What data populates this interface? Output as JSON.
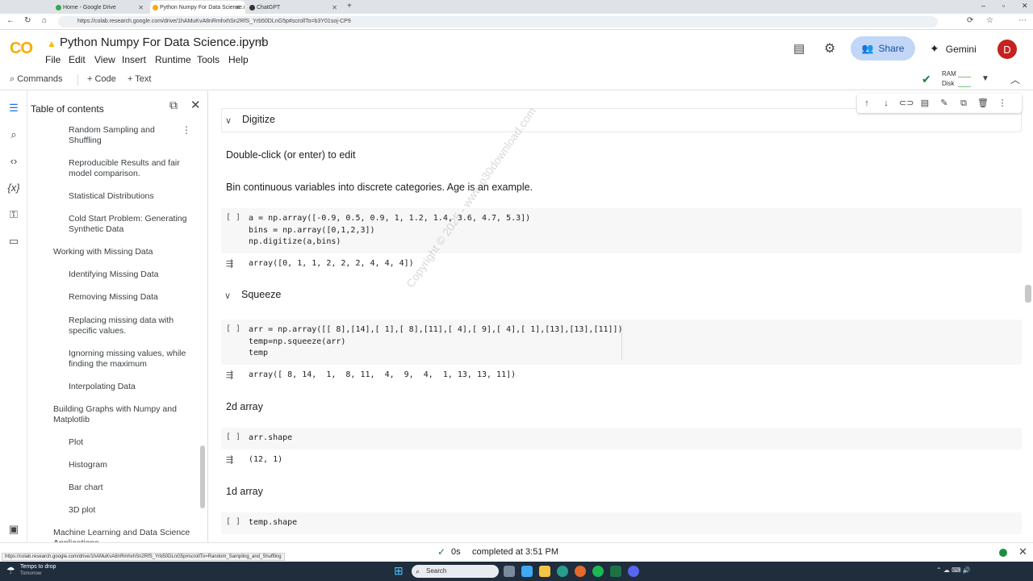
{
  "browser": {
    "tabs": [
      {
        "label": "Home - Google Drive",
        "active": false
      },
      {
        "label": "Python Numpy For Data Science.i",
        "active": true
      },
      {
        "label": "ChatGPT",
        "active": false
      }
    ],
    "url": "https://colab.research.google.com/drive/1hAMuKvA8nRmhxhSn2RfS_Yrb50DLnG5p#scrollTo=b3Y01soj-CP9"
  },
  "header": {
    "logo": "CO",
    "title": "Python Numpy For Data Science.ipynb",
    "menus": [
      "File",
      "Edit",
      "View",
      "Insert",
      "Runtime",
      "Tools",
      "Help"
    ],
    "share_label": "Share",
    "gemini_label": "Gemini",
    "avatar_letter": "D"
  },
  "toolbar": {
    "commands_label": "Commands",
    "code_label": "+ Code",
    "text_label": "+ Text",
    "ram_label": "RAM",
    "disk_label": "Disk"
  },
  "toc": {
    "title": "Table of contents",
    "items": [
      {
        "label": "Random Sampling and Shuffling",
        "level": 2
      },
      {
        "label": "Reproducible Results and fair model comparison.",
        "level": 2
      },
      {
        "label": "Statistical Distributions",
        "level": 2
      },
      {
        "label": "Cold Start Problem: Generating Synthetic Data",
        "level": 2
      },
      {
        "label": "Working with Missing Data",
        "level": 1
      },
      {
        "label": "Identifying Missing Data",
        "level": 2
      },
      {
        "label": "Removing Missing Data",
        "level": 2
      },
      {
        "label": "Replacing missing data with specific values.",
        "level": 2
      },
      {
        "label": "Ignorning missing values, while finding the maximum",
        "level": 2
      },
      {
        "label": "Interpolating Data",
        "level": 2
      },
      {
        "label": "Building Graphs with Numpy and Matplotlib",
        "level": 1
      },
      {
        "label": "Plot",
        "level": 2
      },
      {
        "label": "Histogram",
        "level": 2
      },
      {
        "label": "Bar chart",
        "level": 2
      },
      {
        "label": "3D plot",
        "level": 2
      },
      {
        "label": "Machine Learning and Data Science Applications",
        "level": 1
      }
    ]
  },
  "notebook": {
    "section_digitize": "Digitize",
    "md_edit": "Double-click (or enter) to edit",
    "md_bin": "Bin continuous variables into discrete categories. Age is an example.",
    "cell1_run": "[ ]",
    "cell1_code": "a = np.array([-0.9, 0.5, 0.9, 1, 1.2, 1.4, 3.6, 4.7, 5.3])\nbins = np.array([0,1,2,3])\nnp.digitize(a,bins)",
    "cell1_output": "array([0, 1, 1, 2, 2, 2, 4, 4, 4])",
    "section_squeeze": "Squeeze",
    "cell2_run": "[ ]",
    "cell2_code": "arr = np.array([[ 8],[14],[ 1],[ 8],[11],[ 4],[ 9],[ 4],[ 1],[13],[13],[11]])\ntemp=np.squeeze(arr)\ntemp",
    "cell2_output": "array([ 8, 14,  1,  8, 11,  4,  9,  4,  1, 13, 13, 11])",
    "md_2d": "2d array",
    "cell3_run": "[ ]",
    "cell3_code": "arr.shape",
    "cell3_output": "(12, 1)",
    "md_1d": "1d array",
    "cell4_run": "[ ]",
    "cell4_code": "temp.shape",
    "watermark": "Copyright © 2025 - www.p30download.com"
  },
  "status": {
    "duration": "0s",
    "completed": "completed at 3:51 PM",
    "hover_url": "https://colab.research.google.com/drive/1hAMuKvA8nRmhxhSn2RfS_Yrb50DLnG5p#scrollTo=Random_Sampling_and_Shuffling"
  },
  "taskbar": {
    "weather_line1": "Temps to drop",
    "weather_line2": "Tomorrow",
    "search_placeholder": "Search"
  },
  "colors": {
    "accent": "#1a73e8",
    "share_bg": "#c2d7f7",
    "logo": "#f9ab00",
    "taskbar": "#1f2d3d",
    "ok_green": "#188038"
  }
}
